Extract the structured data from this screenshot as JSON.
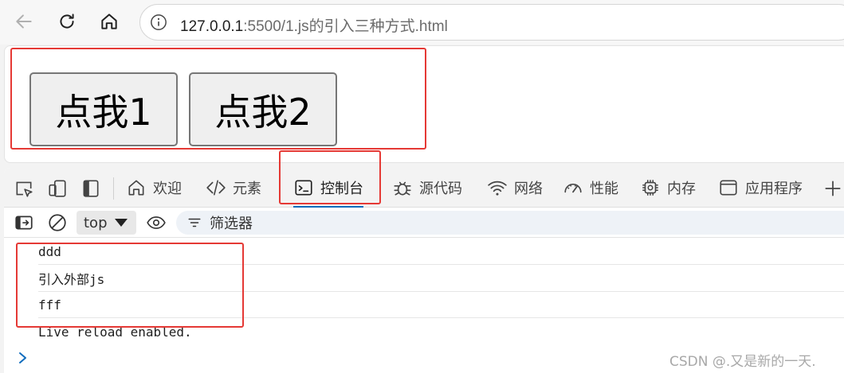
{
  "browser": {
    "url_host": "127.0.0.1",
    "url_rest": ":5500/1.js的引入三种方式.html"
  },
  "page": {
    "buttons": [
      "点我1",
      "点我2"
    ]
  },
  "devtools": {
    "tabs": [
      {
        "label": "欢迎",
        "icon": "home-icon"
      },
      {
        "label": "元素",
        "icon": "code-icon"
      },
      {
        "label": "控制台",
        "icon": "console-icon"
      },
      {
        "label": "源代码",
        "icon": "bug-icon"
      },
      {
        "label": "网络",
        "icon": "wifi-icon"
      },
      {
        "label": "性能",
        "icon": "gauge-icon"
      },
      {
        "label": "内存",
        "icon": "chip-icon"
      },
      {
        "label": "应用程序",
        "icon": "window-icon"
      }
    ],
    "context": "top",
    "filter_placeholder": "筛选器",
    "console_lines": [
      "ddd",
      "引入外部js",
      "fff",
      "Live reload enabled."
    ]
  },
  "watermark": "CSDN @.又是新的一天.",
  "colors": {
    "highlight": "#e53935",
    "active_tab": "#0f6cbd"
  }
}
